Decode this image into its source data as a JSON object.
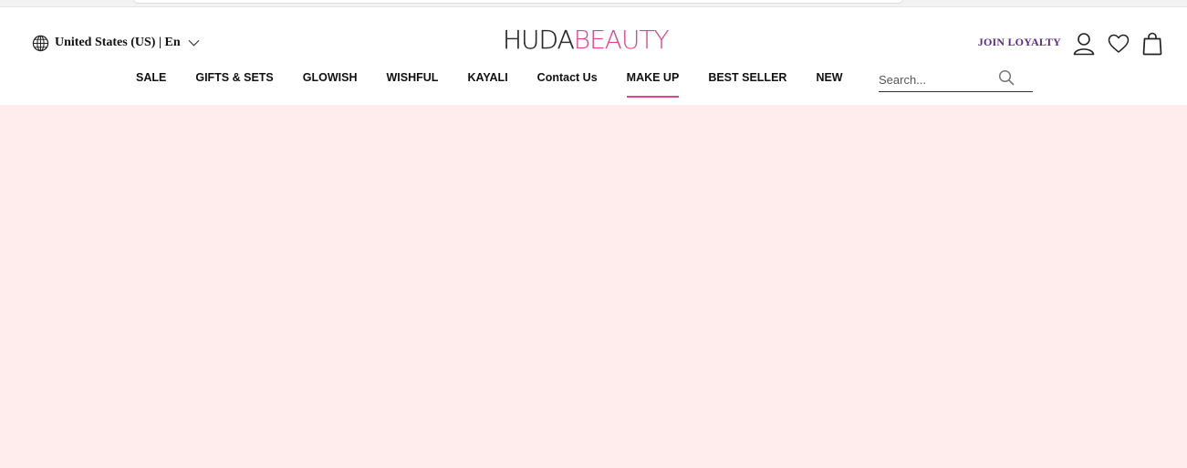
{
  "header": {
    "locale_label": "United States (US) | En",
    "logo": {
      "part_a": "HUDA",
      "part_b": "BEAUTY"
    },
    "join_loyalty": "JOIN LOYALTY"
  },
  "nav": {
    "items": [
      {
        "label": "SALE"
      },
      {
        "label": "GIFTS & SETS"
      },
      {
        "label": "GLOWISH"
      },
      {
        "label": "WISHFUL"
      },
      {
        "label": "KAYALI"
      },
      {
        "label": "Contact Us"
      },
      {
        "label": "MAKE UP",
        "active": true
      },
      {
        "label": "BEST SELLER"
      },
      {
        "label": "NEW"
      }
    ]
  },
  "search": {
    "placeholder": "Search..."
  },
  "colors": {
    "accent_pink": "#e0448e",
    "loyalty_purple": "#5a2a8a",
    "hero_background": "#ffeded"
  },
  "icons": [
    "globe-icon",
    "chevron-down-icon",
    "account-icon",
    "heart-icon",
    "shopping-bag-icon",
    "search-icon"
  ]
}
